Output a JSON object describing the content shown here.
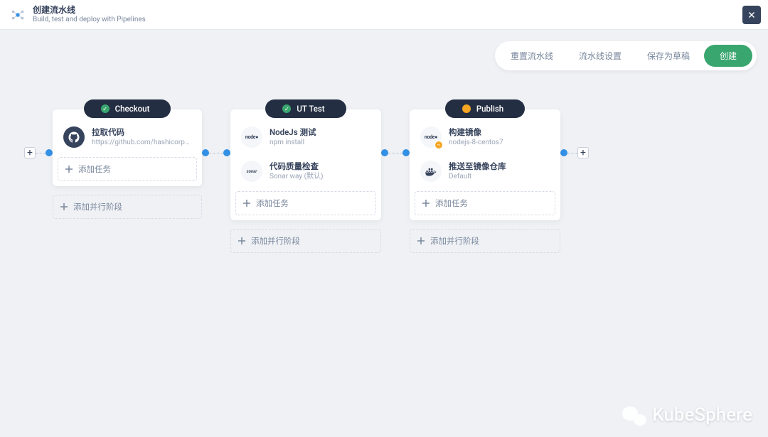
{
  "header": {
    "title": "创建流水线",
    "subtitle": "Build, test and deploy with Pipelines"
  },
  "toolbar": {
    "reset": "重置流水线",
    "settings": "流水线设置",
    "save_draft": "保存为草稿",
    "create": "创建"
  },
  "stages": [
    {
      "name": "Checkout",
      "status": "green",
      "status_mark": "✓",
      "tasks": [
        {
          "icon": "github",
          "title": "拉取代码",
          "sub": "https://github.com/hashicorp/ter..."
        }
      ]
    },
    {
      "name": "UT Test",
      "status": "green",
      "status_mark": "✓",
      "tasks": [
        {
          "icon": "nodejs-light",
          "title": "NodeJs 测试",
          "sub": "npm install"
        },
        {
          "icon": "sonar-light",
          "title": "代码质量检查",
          "sub": "Sonar way (默认)"
        }
      ]
    },
    {
      "name": "Publish",
      "status": "orange",
      "status_mark": "",
      "tasks": [
        {
          "icon": "nodejs-light-badge",
          "title": "构建镜像",
          "sub": "nodejs-8-centos7"
        },
        {
          "icon": "docker-light",
          "title": "推送至镜像仓库",
          "sub": "Default"
        }
      ]
    }
  ],
  "labels": {
    "add_task": "添加任务",
    "add_parallel_stage": "添加并行阶段"
  },
  "watermark": "KubeSphere"
}
